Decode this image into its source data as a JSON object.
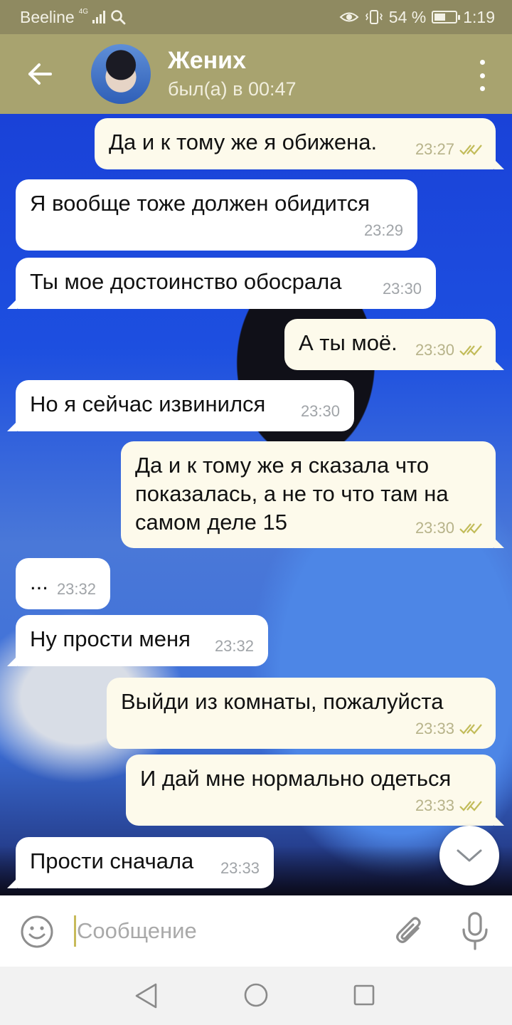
{
  "status_bar": {
    "carrier": "Beeline",
    "network": "4G",
    "battery_percent": "54 %",
    "battery_level": 0.54,
    "time": "1:19"
  },
  "header": {
    "contact_name": "Жених",
    "contact_status": "был(а) в 00:47"
  },
  "messages": [
    {
      "direction": "out",
      "text": "Да и к тому же я обижена.",
      "time": "23:27",
      "read": true
    },
    {
      "direction": "in",
      "text": "Я вообще тоже должен обидится",
      "time": "23:29"
    },
    {
      "direction": "in",
      "text": "Ты мое достоинство обосрала",
      "time": "23:30"
    },
    {
      "direction": "out",
      "text": "А ты моё.",
      "time": "23:30",
      "read": true
    },
    {
      "direction": "in",
      "text": "Но я сейчас извинился",
      "time": "23:30"
    },
    {
      "direction": "out",
      "text": "Да и к тому же я сказала что\nпоказалась, а не то что там на\nсамом деле 15",
      "time": "23:30",
      "read": true
    },
    {
      "direction": "in",
      "text": "...",
      "time": "23:32"
    },
    {
      "direction": "in",
      "text": "Ну прости меня",
      "time": "23:32"
    },
    {
      "direction": "out",
      "text": "Выйди из комнаты, пожалуйста",
      "time": "23:33",
      "read": true
    },
    {
      "direction": "out",
      "text": "И дай мне нормально одеться",
      "time": "23:33",
      "read": true
    },
    {
      "direction": "in",
      "text": "Прости сначала",
      "time": "23:33"
    }
  ],
  "composer": {
    "placeholder": "Сообщение",
    "value": ""
  },
  "icons": {
    "back": "arrow-left-icon",
    "menu": "more-vertical-icon",
    "scroll_down": "chevron-down-icon",
    "emoji": "smile-icon",
    "attach": "paperclip-icon",
    "mic": "microphone-icon",
    "read": "double-check-icon"
  },
  "colors": {
    "header": "#a8a36f",
    "status_bar": "#8f8a61",
    "outgoing_bubble": "#fdfaeb",
    "incoming_bubble": "#ffffff",
    "read_ticks": "#c2bc5a",
    "cursor": "#c7ba5a"
  }
}
